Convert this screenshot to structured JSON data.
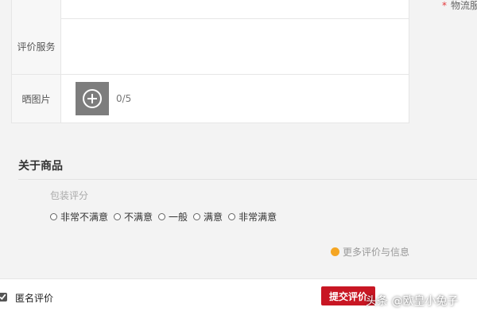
{
  "form": {
    "service_label": "评价服务",
    "photos_label": "晒图片",
    "photo_count": "0/5",
    "logistics_note": "物流服",
    "required_mark": "*"
  },
  "product": {
    "section_title": "关于商品",
    "packaging_label": "包装评分",
    "options": [
      "非常不满意",
      "不满意",
      "一般",
      "满意",
      "非常满意"
    ],
    "more_link": "更多评价与信息"
  },
  "footer": {
    "anonymous_label": "匿名评价",
    "anonymous_checked": true,
    "submit_label": "提交评价"
  },
  "watermark": "头条 @欧皇小兔子",
  "colors": {
    "submit_bg": "#c81623",
    "required": "#e4393c",
    "more_dot": "#f5a623"
  }
}
